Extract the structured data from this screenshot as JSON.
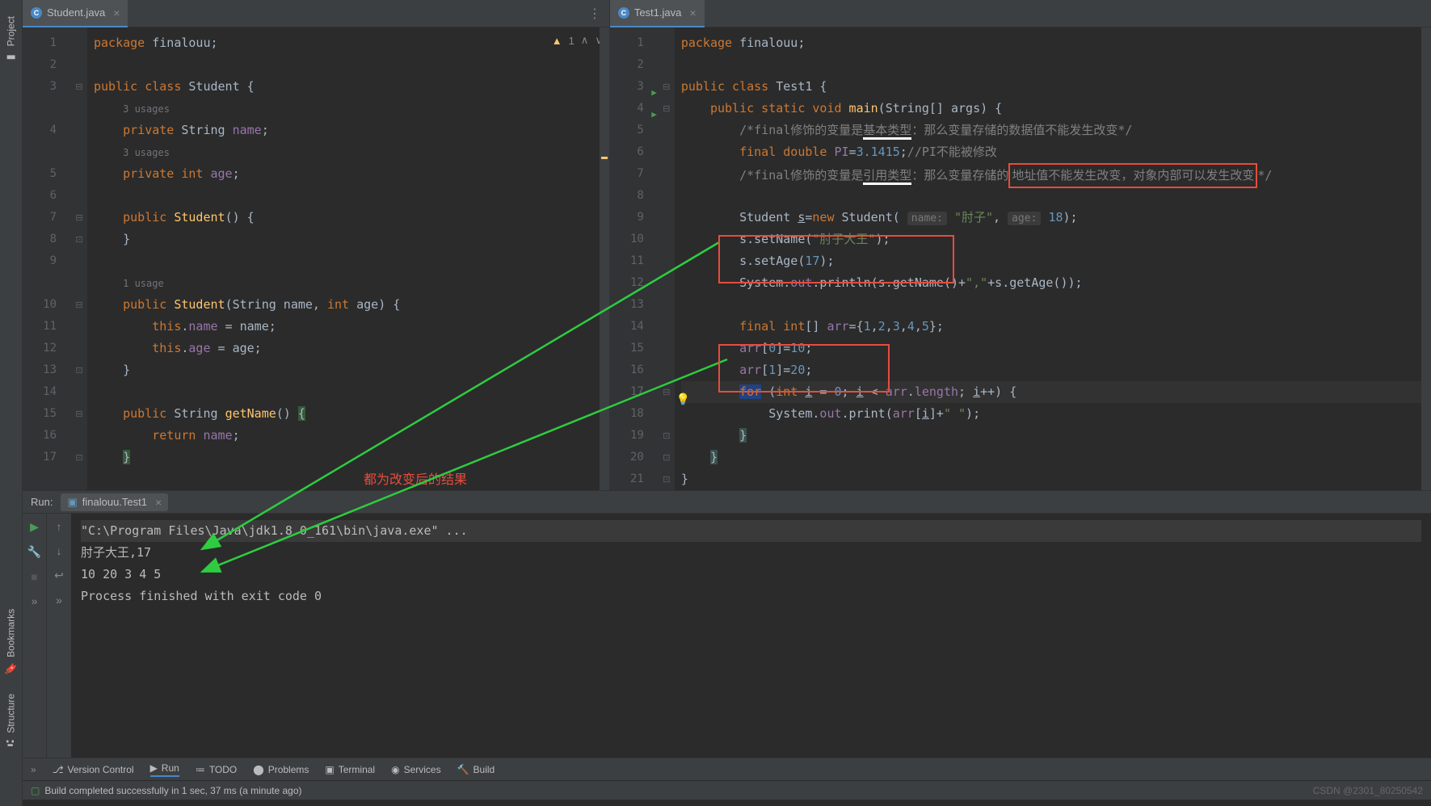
{
  "sidebar": {
    "project": "Project",
    "bookmarks": "Bookmarks",
    "structure": "Structure"
  },
  "left_editor": {
    "tab_label": "Student.java",
    "warning_count": "1",
    "lines": [
      {
        "n": "1",
        "html": "<span class='kw'>package</span> finalouu;"
      },
      {
        "n": "2",
        "html": ""
      },
      {
        "n": "3",
        "html": "<span class='kw'>public class</span> Student {"
      },
      {
        "n": "",
        "html": "    <span class='usage'>3 usages</span>"
      },
      {
        "n": "4",
        "html": "    <span class='kw'>private</span> String <span class='field'>name</span>;"
      },
      {
        "n": "",
        "html": "    <span class='usage'>3 usages</span>"
      },
      {
        "n": "5",
        "html": "    <span class='kw'>private int</span> <span class='field'>age</span>;"
      },
      {
        "n": "6",
        "html": ""
      },
      {
        "n": "7",
        "html": "    <span class='kw'>public</span> <span class='method'>Student</span>() {"
      },
      {
        "n": "8",
        "html": "    }"
      },
      {
        "n": "9",
        "html": ""
      },
      {
        "n": "",
        "html": "    <span class='usage'>1 usage</span>"
      },
      {
        "n": "10",
        "html": "    <span class='kw'>public</span> <span class='method'>Student</span>(String name, <span class='kw'>int</span> age) {"
      },
      {
        "n": "11",
        "html": "        <span class='kw'>this</span>.<span class='field'>name</span> = name;"
      },
      {
        "n": "12",
        "html": "        <span class='kw'>this</span>.<span class='field'>age</span> = age;"
      },
      {
        "n": "13",
        "html": "    }"
      },
      {
        "n": "14",
        "html": ""
      },
      {
        "n": "15",
        "html": "    <span class='kw'>public</span> String <span class='method'>getName</span>() <span style='background:#36593b'>{</span>"
      },
      {
        "n": "16",
        "html": "        <span class='kw'>return</span> <span class='field'>name</span>;"
      },
      {
        "n": "17",
        "html": "    <span style='background:#36593b'>}</span>"
      }
    ]
  },
  "right_editor": {
    "tab_label": "Test1.java",
    "lines": [
      {
        "n": "1",
        "html": "<span class='kw'>package</span> finalouu;"
      },
      {
        "n": "2",
        "html": ""
      },
      {
        "n": "3",
        "html": "<span class='kw'>public class</span> Test1 {",
        "run": true
      },
      {
        "n": "4",
        "html": "    <span class='kw'>public static void</span> <span class='method'>main</span>(String[] args) {",
        "run": true
      },
      {
        "n": "5",
        "html": "        <span class='comment'>/*final修饰的变量是</span><span class='comment underline1'>基本类型</span><span class='comment'>：那么变量存储的数据值不能发生改变*/</span>"
      },
      {
        "n": "6",
        "html": "        <span class='kw'>final double</span> <span class='field'>PI</span>=<span class='num'>3.1415</span>;<span class='comment'>//PI不能被修改</span>"
      },
      {
        "n": "7",
        "html": "        <span class='comment'>/*final修饰的变量是</span><span class='comment underline1'>引用类型</span><span class='comment'>：那么变量存储的</span><span class='red-box comment'>地址值不能发生改变，对象内部可以发生改变</span><span class='comment'>*/</span>"
      },
      {
        "n": "8",
        "html": ""
      },
      {
        "n": "9",
        "html": "        Student <span style='text-decoration:underline'>s</span>=<span class='kw'>new</span> Student( <span class='hint'>name:</span> <span class='str'>\"肘子\"</span>, <span class='hint'>age:</span> <span class='num'>18</span>);"
      },
      {
        "n": "10",
        "html": "        s.setName(<span class='str'>\"肘子大王\"</span>);"
      },
      {
        "n": "11",
        "html": "        s.setAge(<span class='num'>17</span>);"
      },
      {
        "n": "12",
        "html": "        System.<span class='field'>out</span>.println(s.getName()+<span class='str'>\",\"</span>+s.getAge());"
      },
      {
        "n": "13",
        "html": ""
      },
      {
        "n": "14",
        "html": "        <span class='kw'>final int</span>[] <span class='field'>arr</span>={<span class='num'>1</span>,<span class='num'>2</span>,<span class='num'>3</span>,<span class='num'>4</span>,<span class='num'>5</span>};"
      },
      {
        "n": "15",
        "html": "        <span class='field'>arr</span>[<span class='num'>0</span>]=<span class='num'>10</span>;"
      },
      {
        "n": "16",
        "html": "        <span class='field'>arr</span>[<span class='num'>1</span>]=<span class='num'>20</span>;"
      },
      {
        "n": "17",
        "html": "        <span style='background:#214283' class='kw'>for</span> (<span class='kw'>int</span> <span style='text-decoration:underline'>i</span> = <span class='num'>0</span>; <span style='text-decoration:underline'>i</span> &lt; <span class='field'>arr</span>.<span class='field'>length</span>; <span style='text-decoration:underline'>i</span>++) {"
      },
      {
        "n": "18",
        "html": "            System.<span class='field'>out</span>.print(<span class='field'>arr</span>[<span style='text-decoration:underline'>i</span>]+<span class='str'>\" \"</span>);"
      },
      {
        "n": "19",
        "html": "        <span style='background:#3b514d'>}</span>"
      },
      {
        "n": "20",
        "html": "    <span style='background:#3b514d'>}</span>"
      },
      {
        "n": "21",
        "html": "}"
      }
    ]
  },
  "run": {
    "label": "Run:",
    "config": "finalouu.Test1",
    "output": [
      "\"C:\\Program Files\\Java\\jdk1.8.0_161\\bin\\java.exe\" ...",
      "肘子大王,17",
      "10 20 3 4 5 ",
      "Process finished with exit code 0"
    ]
  },
  "annotation_text": "都为改变后的结果",
  "bottom_tools": {
    "vcs": "Version Control",
    "run": "Run",
    "todo": "TODO",
    "problems": "Problems",
    "terminal": "Terminal",
    "services": "Services",
    "build": "Build"
  },
  "status": {
    "left": "Build completed successfully in 1 sec, 37 ms (a minute ago)",
    "right": "CSDN @2301_80250542"
  }
}
